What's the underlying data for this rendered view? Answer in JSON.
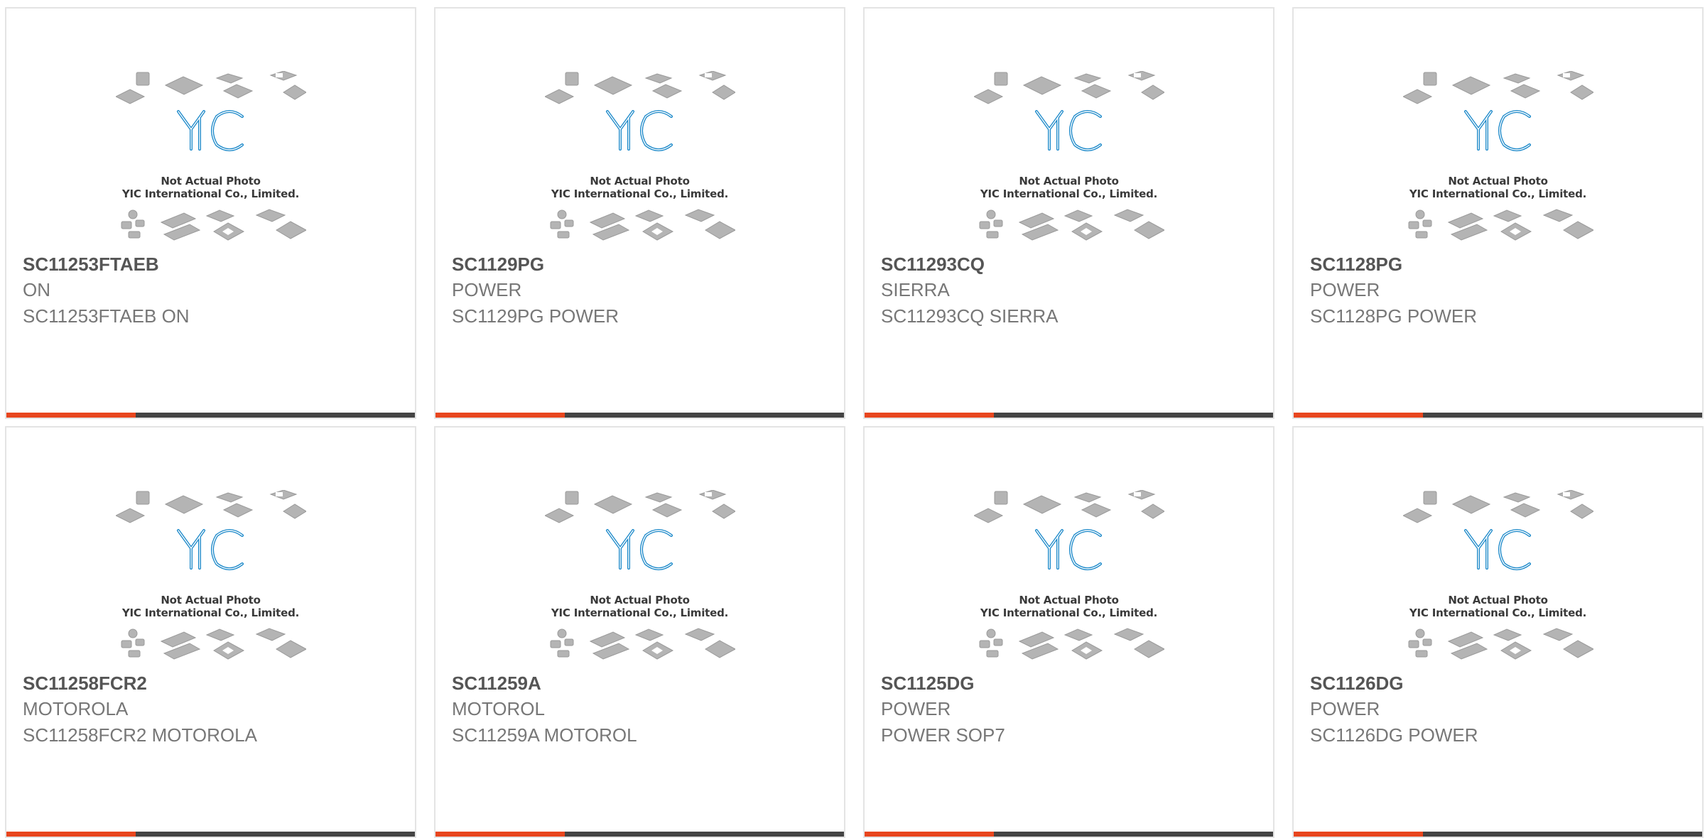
{
  "accent_colors": {
    "orange": "#e8461e",
    "dark": "#444444",
    "logo_blue": "#1a88c9"
  },
  "thumbnail": {
    "logo_text": "YIC",
    "caption_line1": "Not Actual Photo",
    "caption_line2": "YIC International Co., Limited."
  },
  "products": [
    {
      "part": "SC11253FTAEB",
      "brand": "ON",
      "desc": "SC11253FTAEB ON"
    },
    {
      "part": "SC1129PG",
      "brand": "POWER",
      "desc": "SC1129PG POWER"
    },
    {
      "part": "SC11293CQ",
      "brand": "SIERRA",
      "desc": "SC11293CQ SIERRA"
    },
    {
      "part": "SC1128PG",
      "brand": "POWER",
      "desc": "SC1128PG POWER"
    },
    {
      "part": "SC11258FCR2",
      "brand": "MOTOROLA",
      "desc": "SC11258FCR2 MOTOROLA"
    },
    {
      "part": "SC11259A",
      "brand": "MOTOROL",
      "desc": "SC11259A MOTOROL"
    },
    {
      "part": "SC1125DG",
      "brand": "POWER",
      "desc": "POWER SOP7"
    },
    {
      "part": "SC1126DG",
      "brand": "POWER",
      "desc": "SC1126DG POWER"
    }
  ]
}
